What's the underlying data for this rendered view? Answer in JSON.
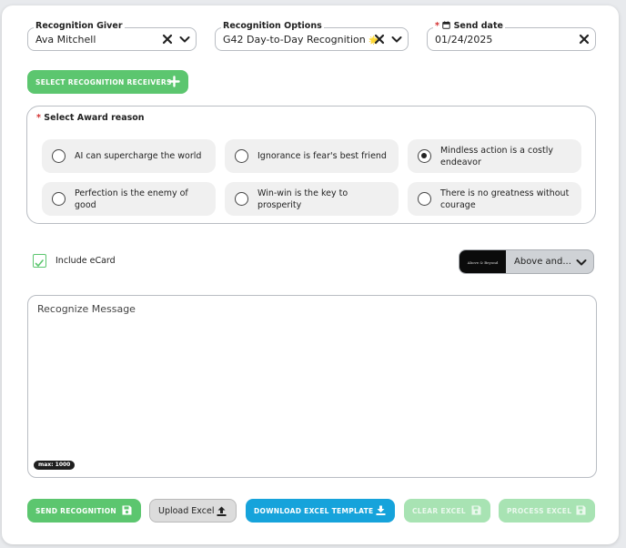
{
  "form": {
    "giver_label": "Recognition Giver",
    "giver_value": "Ava Mitchell",
    "options_label": "Recognition Options",
    "options_value": "G42 Day-to-Day Recognition",
    "options_emoji": "🌟",
    "send_date_required": "*",
    "send_date_label": "Send date",
    "send_date_value": "01/24/2025",
    "select_receivers_label": "SELECT RECOGNITION RECEIVERS"
  },
  "award": {
    "required": "*",
    "title": "Select Award reason",
    "options": [
      {
        "label": "AI can supercharge the world",
        "selected": false
      },
      {
        "label": "Ignorance is fear's best friend",
        "selected": false
      },
      {
        "label": "Mindless action is a costly endeavor",
        "selected": true
      },
      {
        "label": "Perfection is the enemy of good",
        "selected": false
      },
      {
        "label": "Win-win is the key to prosperity",
        "selected": false
      },
      {
        "label": "There is no greatness without courage",
        "selected": false
      }
    ]
  },
  "ecard": {
    "include_label": "Include eCard",
    "checked": true,
    "thumb_text": "Above & Beyond",
    "selected_value": "Above and..."
  },
  "message": {
    "placeholder": "Recognize Message",
    "max_badge": "max: 1000"
  },
  "actions": {
    "send": "SEND RECOGNITION",
    "upload": "Upload Excel",
    "download": "DOWNLOAD EXCEL TEMPLATE",
    "clear": "CLEAR EXCEL",
    "process": "PROCESS EXCEL"
  },
  "colors": {
    "accent_green": "#5cc66f",
    "disabled_green": "#a8e3b3",
    "accent_blue": "#16a3db",
    "required_red": "#d32f2f"
  },
  "icons": [
    "x-icon",
    "chevron-down-icon",
    "calendar-icon",
    "plus-icon",
    "save-icon",
    "upload-icon",
    "download-icon",
    "check-icon"
  ]
}
